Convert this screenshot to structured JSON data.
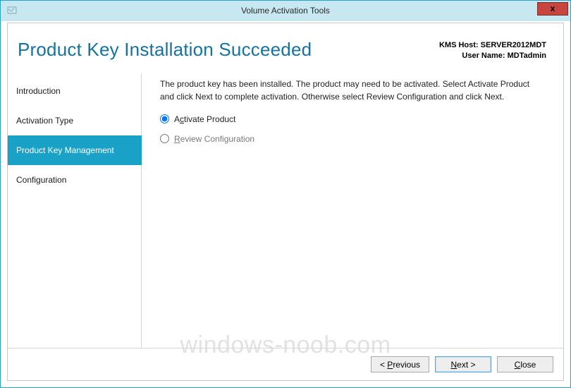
{
  "window": {
    "title": "Volume Activation Tools"
  },
  "header": {
    "title": "Product Key Installation Succeeded",
    "kms_host_label": "KMS Host:",
    "kms_host_value": "SERVER2012MDT",
    "user_label": "User Name:",
    "user_value": "MDTadmin"
  },
  "sidebar": {
    "items": [
      "Introduction",
      "Activation Type",
      "Product Key Management",
      "Configuration"
    ],
    "selected_index": 2
  },
  "content": {
    "description": "The product key has been installed. The product may need to be activated. Select Activate Product and click Next to complete activation. Otherwise select Review Configuration and click Next.",
    "options": [
      {
        "prefix": "A",
        "accel": "c",
        "suffix": "tivate Product",
        "selected": true,
        "enabled": true
      },
      {
        "prefix": "",
        "accel": "R",
        "suffix": "eview Configuration",
        "selected": false,
        "enabled": false
      }
    ]
  },
  "footer": {
    "previous": {
      "lt": "< ",
      "accel": "P",
      "rest": "revious"
    },
    "next": {
      "accel": "N",
      "rest": "ext >"
    },
    "close": {
      "accel": "C",
      "rest": "lose"
    }
  },
  "watermark": "windows-noob.com"
}
